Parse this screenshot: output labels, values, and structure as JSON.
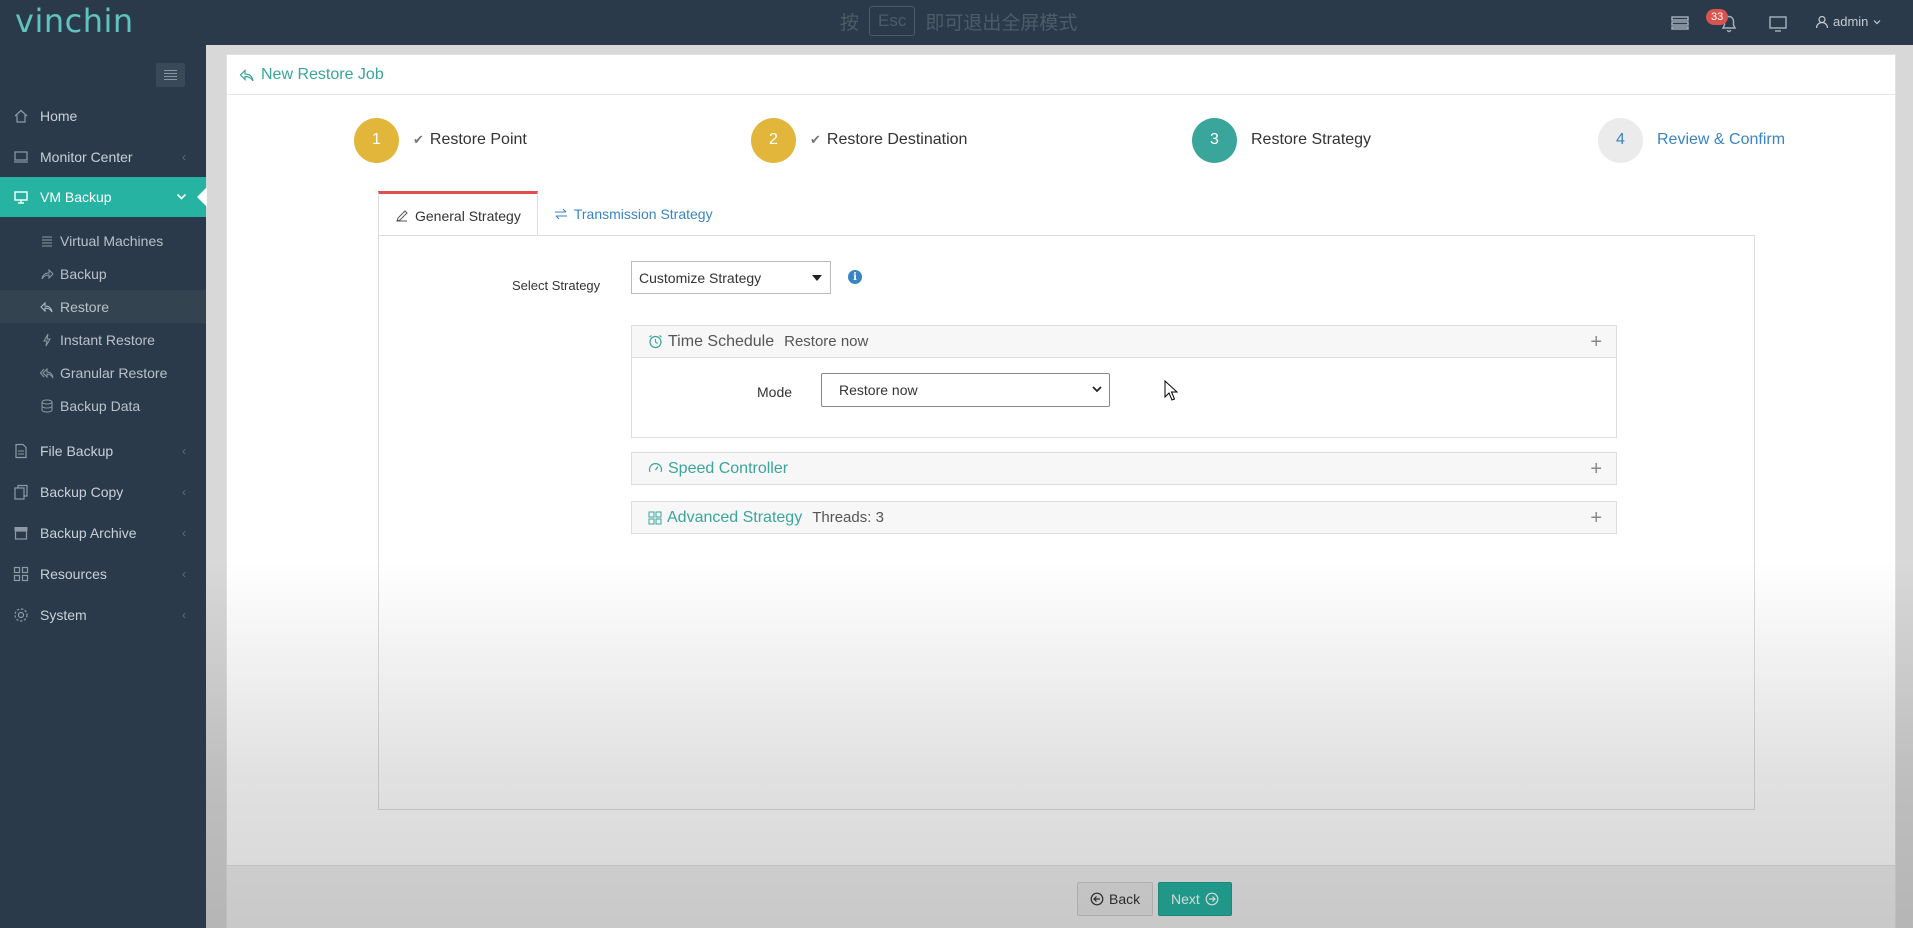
{
  "topbar": {
    "logo_vin": "vin",
    "logo_chin": "chin",
    "esc_prefix": "按",
    "esc_key": "Esc",
    "esc_suffix": "即可退出全屏模式",
    "notification_count": "33",
    "user": "admin"
  },
  "sidebar": {
    "items": [
      {
        "label": "Home",
        "icon": "home-icon"
      },
      {
        "label": "Monitor Center",
        "icon": "monitor-icon"
      },
      {
        "label": "VM Backup",
        "icon": "desktop-icon"
      },
      {
        "label": "File Backup",
        "icon": "file-icon"
      },
      {
        "label": "Backup Copy",
        "icon": "copy-icon"
      },
      {
        "label": "Backup Archive",
        "icon": "archive-icon"
      },
      {
        "label": "Resources",
        "icon": "grid-icon"
      },
      {
        "label": "System",
        "icon": "gear-icon"
      }
    ],
    "sub_items": [
      {
        "label": "Virtual Machines",
        "icon": "list-icon"
      },
      {
        "label": "Backup",
        "icon": "share-icon"
      },
      {
        "label": "Restore",
        "icon": "reply-icon"
      },
      {
        "label": "Instant Restore",
        "icon": "bolt-icon"
      },
      {
        "label": "Granular Restore",
        "icon": "reply-all-icon"
      },
      {
        "label": "Backup Data",
        "icon": "database-icon"
      }
    ]
  },
  "page": {
    "title": "New Restore Job"
  },
  "steps": [
    {
      "number": "1",
      "label": "Restore Point",
      "done": true,
      "color": "#e2b63b"
    },
    {
      "number": "2",
      "label": "Restore Destination",
      "done": true,
      "color": "#e2b63b"
    },
    {
      "number": "3",
      "label": "Restore Strategy",
      "done": false,
      "color": "#3aa59b"
    },
    {
      "number": "4",
      "label": "Review & Confirm",
      "done": false,
      "color": "#ebebeb"
    }
  ],
  "tabs": {
    "general": "General Strategy",
    "transmission": "Transmission Strategy"
  },
  "strategy": {
    "label": "Select Strategy",
    "value": "Customize Strategy"
  },
  "time_schedule": {
    "title": "Time Schedule",
    "summary": "Restore now",
    "mode_label": "Mode",
    "mode_value": "Restore now"
  },
  "speed_controller": {
    "title": "Speed Controller"
  },
  "advanced_strategy": {
    "title": "Advanced Strategy",
    "summary": "Threads: 3"
  },
  "footer": {
    "back": "Back",
    "next": "Next"
  },
  "colors": {
    "accent": "#26b3a1",
    "sidebar_bg": "#2b3a4a",
    "step_done": "#e2b63b",
    "step_current": "#3aa59b",
    "tab_active_border": "#e04e4e",
    "link_blue": "#3a84c4"
  }
}
